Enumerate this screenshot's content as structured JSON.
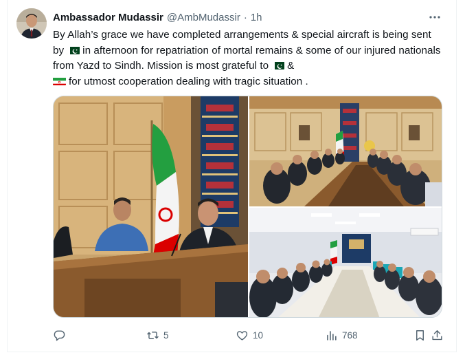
{
  "tweet": {
    "display_name": "Ambassador Mudassir",
    "handle": "@AmbMudassir",
    "separator": "·",
    "time": "1h",
    "text": {
      "part1": "By Allah’s grace we have completed arrangements & special aircraft is being sent by",
      "part2": "in afternoon for repatriation of mortal remains & some of our injured nationals from Yazd to Sindh. Mission is most grateful to",
      "part3": "&",
      "part4": "for utmost cooperation dealing with tragic situation .",
      "flags": [
        "pakistan-flag-emoji",
        "pakistan-flag-emoji",
        "iran-flag-emoji"
      ]
    },
    "media": [
      {
        "name": "meeting-photo-officials-with-iran-flag"
      },
      {
        "name": "meeting-photo-conference-table-wide"
      },
      {
        "name": "meeting-photo-white-conference-room"
      }
    ],
    "actions": {
      "reply_count": "",
      "retweet_count": "5",
      "like_count": "10",
      "views_count": "768"
    }
  },
  "icons": [
    "more-icon",
    "reply-icon",
    "retweet-icon",
    "like-icon",
    "views-icon",
    "bookmark-icon",
    "share-icon"
  ],
  "colors": {
    "text_primary": "#0f1419",
    "text_secondary": "#536471",
    "border": "#cfd9de",
    "pakistan_green": "#01411c",
    "iran_green": "#239f40",
    "iran_red": "#da0000"
  }
}
